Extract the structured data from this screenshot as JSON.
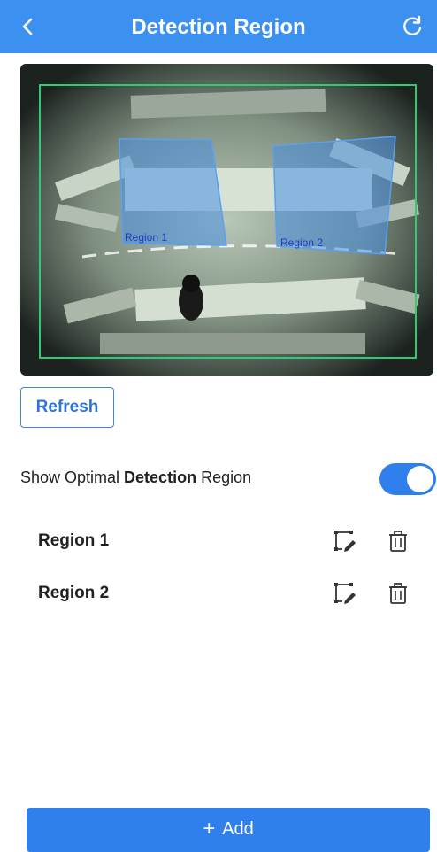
{
  "header": {
    "title": "Detection Region",
    "back_icon": "chevron-left-icon",
    "refresh_icon": "reload-icon"
  },
  "camera": {
    "regions": [
      {
        "label": "Region 1"
      },
      {
        "label": "Region 2"
      }
    ],
    "overlay_color": "#2ecc71",
    "region_fill": "#4a90e2"
  },
  "refresh_button": {
    "label": "Refresh"
  },
  "optimal_toggle": {
    "label_part1": "Show Optimal ",
    "label_part2": "Detection",
    "label_part3": " Region",
    "enabled": true
  },
  "regions_list": [
    {
      "name": "Region 1",
      "edit_icon": "edit-region-icon",
      "delete_icon": "trash-icon"
    },
    {
      "name": "Region 2",
      "edit_icon": "edit-region-icon",
      "delete_icon": "trash-icon"
    }
  ],
  "add_button": {
    "plus": "+",
    "label": "Add"
  },
  "colors": {
    "primary": "#3b90f0",
    "button": "#2f80ed"
  }
}
